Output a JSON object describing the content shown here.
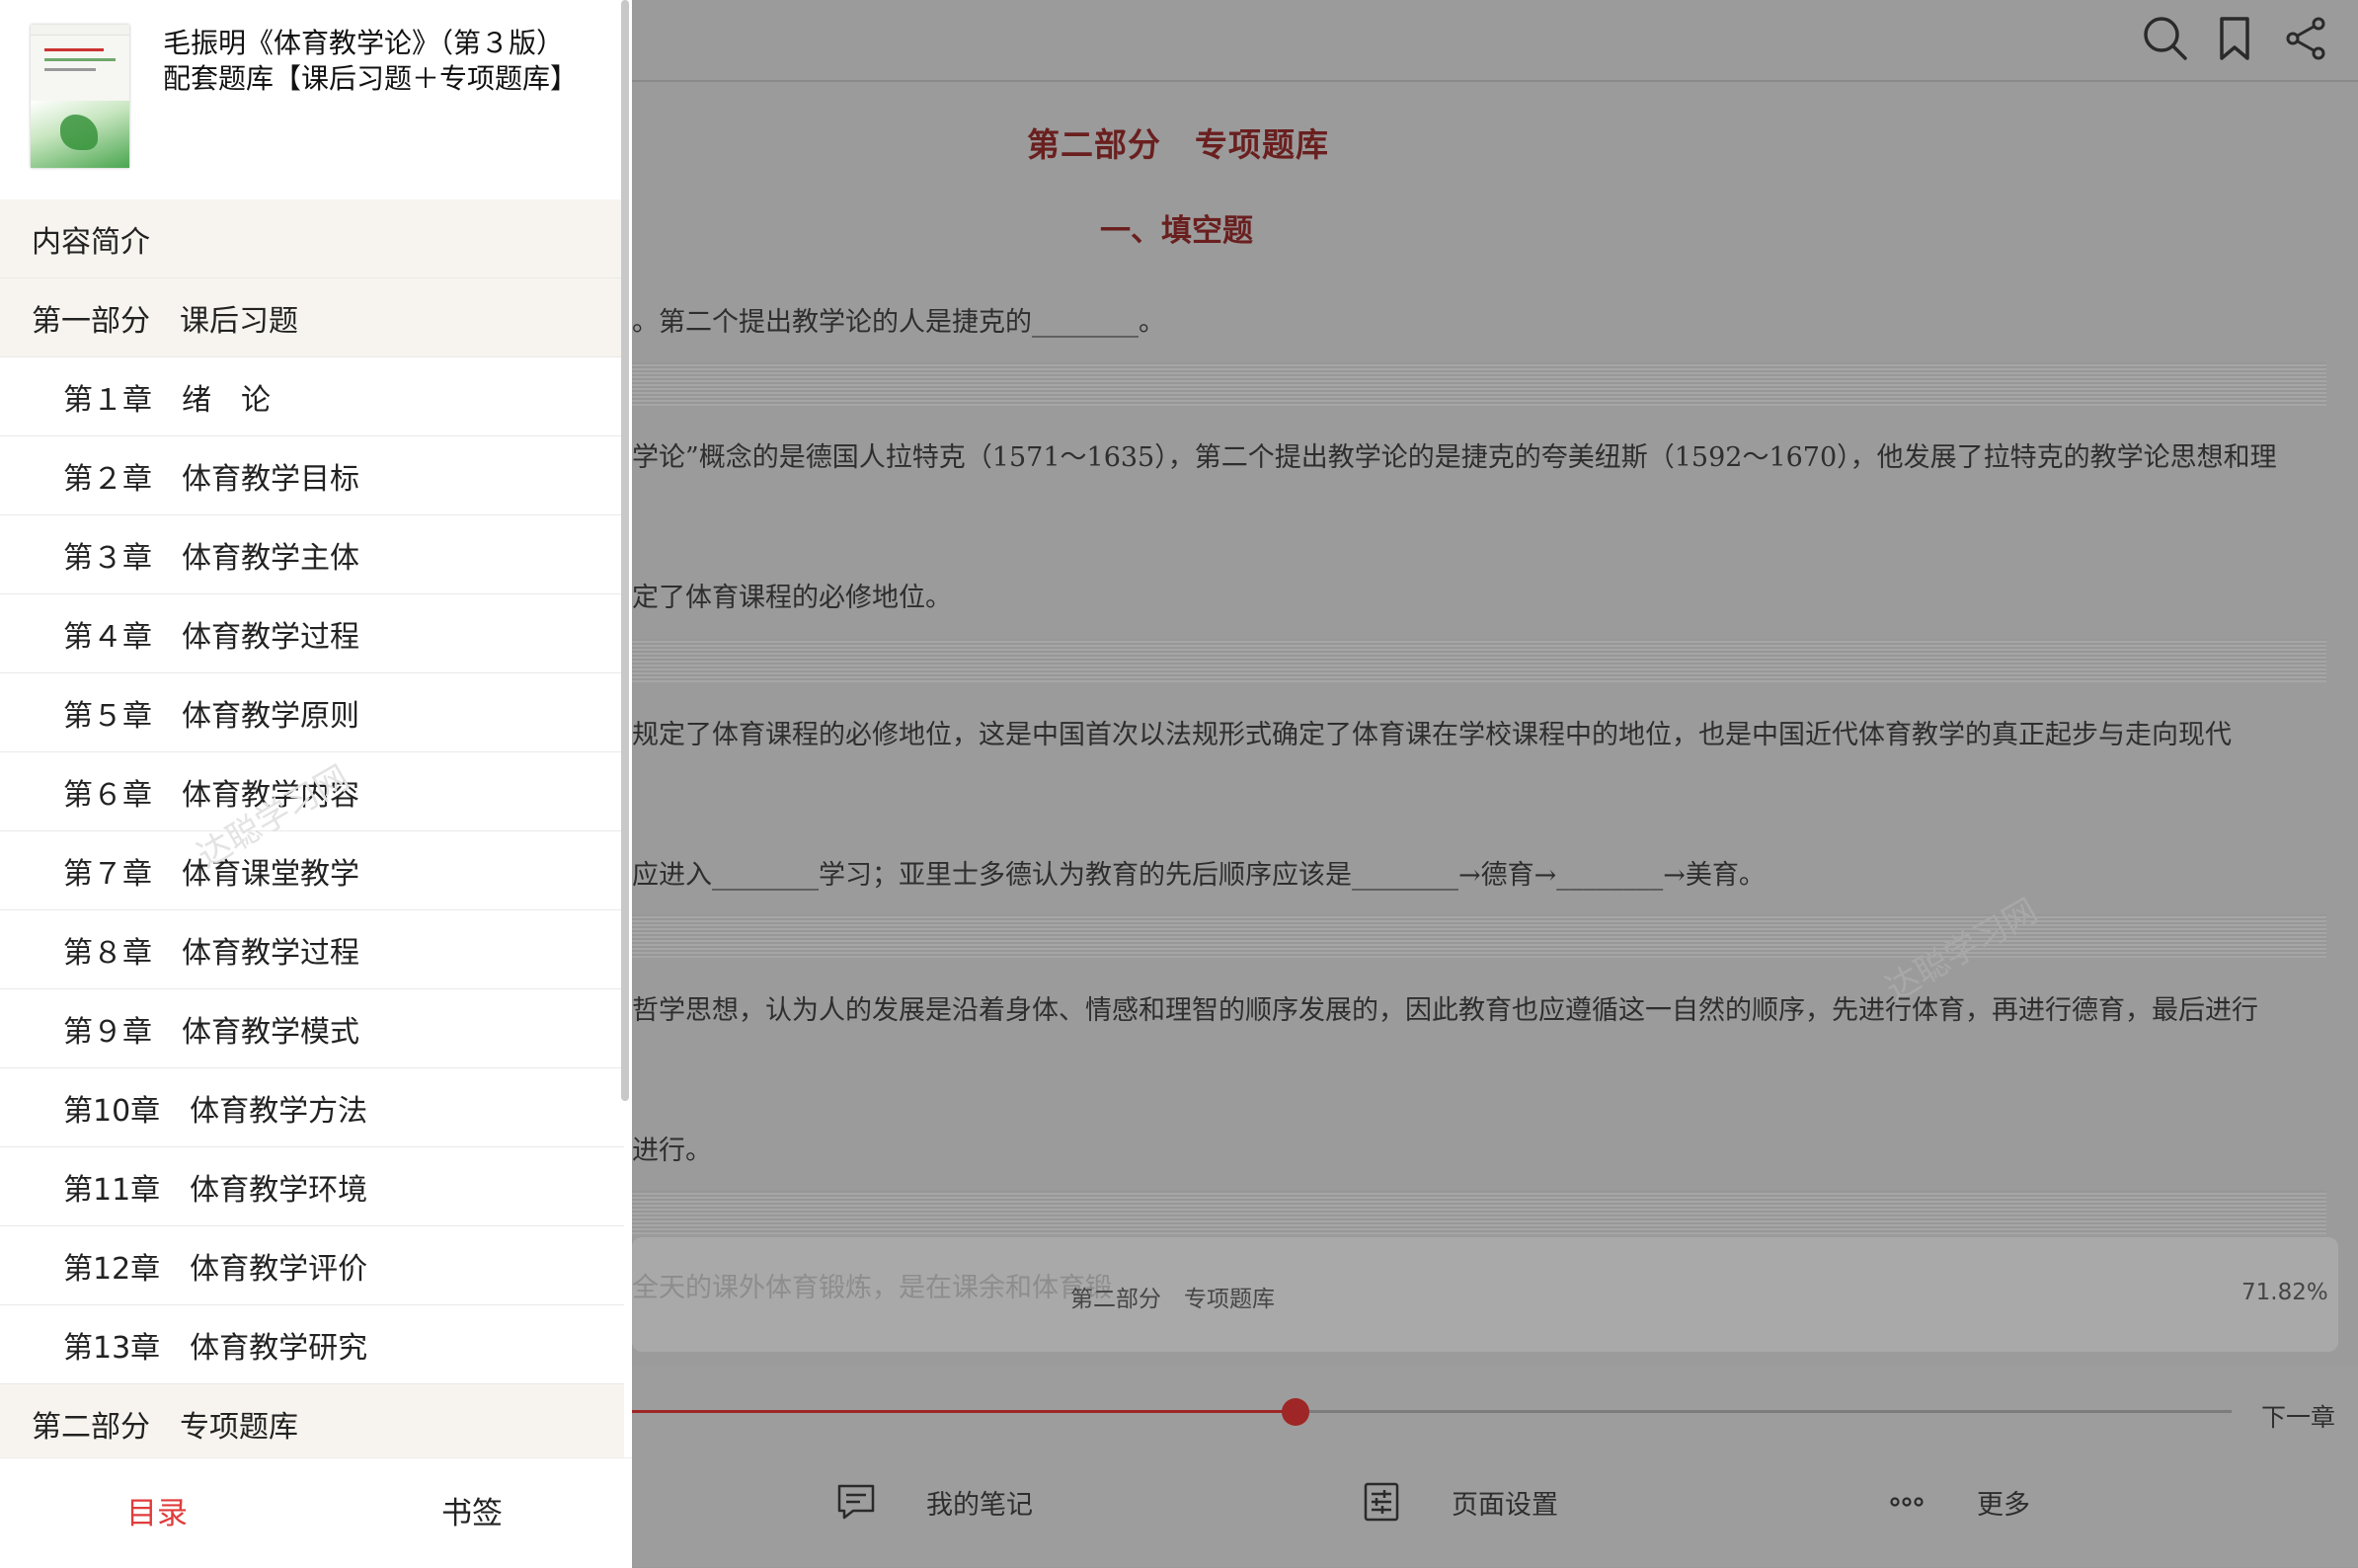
{
  "book": {
    "title_line1": "毛振明《体育教学论》（第３版）",
    "title_line2": "配套题库【课后习题＋专项题库】"
  },
  "toc": [
    {
      "label": "内容简介",
      "level": "part"
    },
    {
      "label": "第一部分　课后习题",
      "level": "part"
    },
    {
      "label": "第１章　绪　论",
      "level": "chap"
    },
    {
      "label": "第２章　体育教学目标",
      "level": "chap"
    },
    {
      "label": "第３章　体育教学主体",
      "level": "chap"
    },
    {
      "label": "第４章　体育教学过程",
      "level": "chap"
    },
    {
      "label": "第５章　体育教学原则",
      "level": "chap"
    },
    {
      "label": "第６章　体育教学内容",
      "level": "chap"
    },
    {
      "label": "第７章　体育课堂教学",
      "level": "chap"
    },
    {
      "label": "第８章　体育教学过程",
      "level": "chap"
    },
    {
      "label": "第９章　体育教学模式",
      "level": "chap"
    },
    {
      "label": "第10章　体育教学方法",
      "level": "chap"
    },
    {
      "label": "第11章　体育教学环境",
      "level": "chap"
    },
    {
      "label": "第12章　体育教学评价",
      "level": "chap"
    },
    {
      "label": "第13章　体育教学研究",
      "level": "chap"
    },
    {
      "label": "第二部分　专项题库",
      "level": "part"
    }
  ],
  "drawer_tabs": {
    "contents": "目录",
    "bookmarks": "书签"
  },
  "watermark": "达聪学习网",
  "reader": {
    "part_title": "第二部分　专项题库",
    "section_title": "一、填空题",
    "lines": [
      "。第二个提出教学论的人是捷克的________。",
      "学论”概念的是德国人拉特克（1571～1635），第二个提出教学论的是捷克的夸美纽斯（1592～1670），他发展了拉特克的教学论思想和理",
      "定了体育课程的必修地位。",
      "规定了体育课程的必修地位，这是中国首次以法规形式确定了体育课在学校课程中的地位，也是中国近代体育教学的真正起步与走向现代",
      "应进入________学习；亚里士多德认为教育的先后顺序应该是________→德育→________→美育。",
      "哲学思想，认为人的发展是沿着身体、情感和理智的顺序发展的，因此教育也应遵循这一自然的顺序，先进行体育，再进行德育，最后进行",
      "进行。"
    ],
    "behind_text": "全天的课外体育锻炼，是在课余和体育锻"
  },
  "status": {
    "section": "第二部分　专项题库",
    "percent": "71.82%"
  },
  "progress": {
    "value": 0.4148
  },
  "toolbar": {
    "next_chapter": "下一章",
    "notes": "我的笔记",
    "page_settings": "页面设置",
    "more": "更多"
  },
  "colors": {
    "accent": "#e03c3c",
    "title_red": "#7a1a1a"
  },
  "icons": [
    "search-icon",
    "bookmark-icon",
    "share-icon",
    "notes-icon",
    "settings-icon",
    "more-icon"
  ]
}
